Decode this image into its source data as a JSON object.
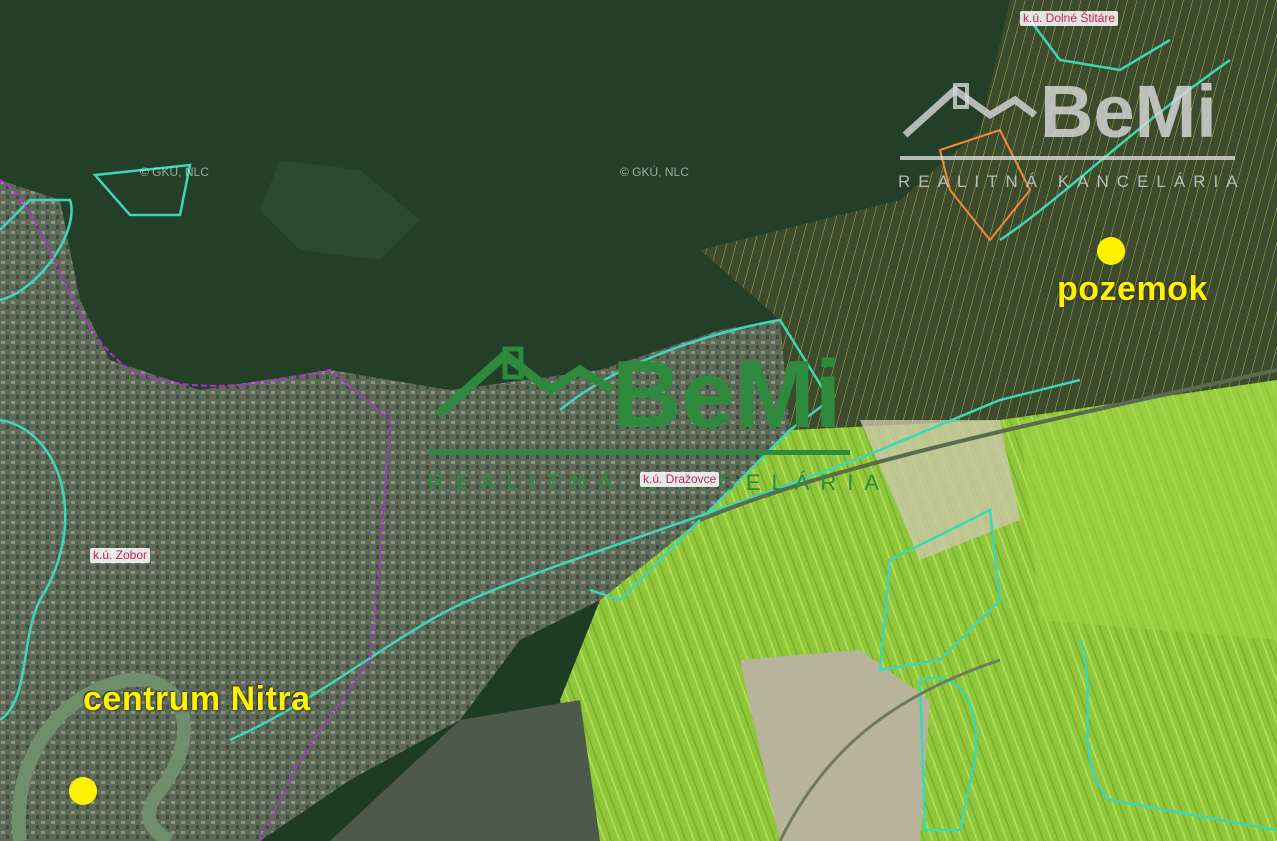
{
  "map": {
    "copyright": "© GKÚ, NLC",
    "cadastral_areas": [
      {
        "name": "k.ú. Dolné Štitáre"
      },
      {
        "name": "k.ú. Zobor"
      },
      {
        "name": "k.ú. Dražovce"
      }
    ],
    "markers": [
      {
        "label": "pozemok",
        "color": "#fff200"
      },
      {
        "label": "centrum Nitra",
        "color": "#fff200"
      }
    ]
  },
  "watermark": {
    "brand": "BeMi",
    "subtitle": "REALITNÁ KANCELÁRIA",
    "color_main": "#2e8b3e",
    "color_faded": "#d8d8d8"
  }
}
